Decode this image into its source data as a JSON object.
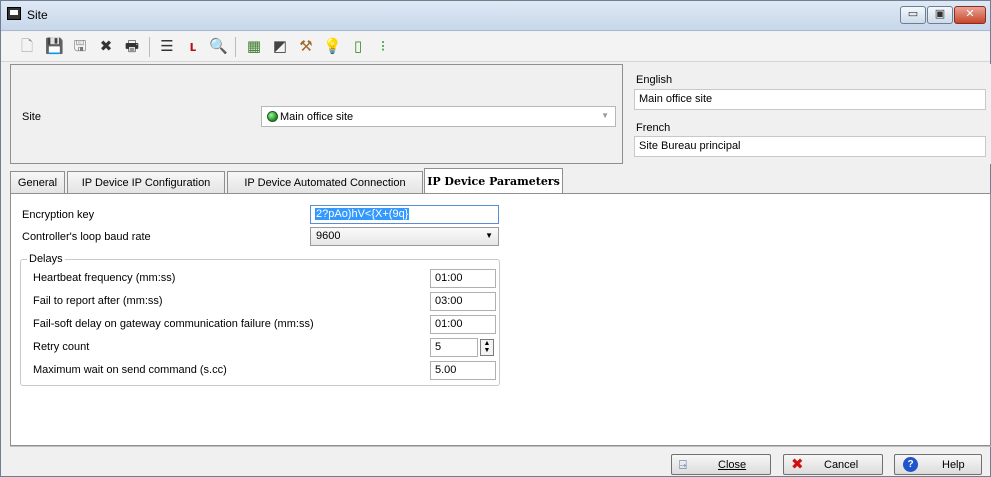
{
  "window": {
    "title": "Site",
    "min_glyph": "▭",
    "max_glyph": "▣",
    "close_glyph": "✕"
  },
  "toolbar": {
    "icons": [
      "new-icon",
      "save-icon",
      "save-copy-icon",
      "delete-icon",
      "print-icon",
      "list-icon",
      "filter-icon",
      "search-icon",
      "map-icon",
      "report-icon",
      "tools-icon",
      "tip-icon",
      "door-icon",
      "traffic-light-icon"
    ]
  },
  "header": {
    "site_label": "Site",
    "site_value": "Main office site",
    "english_label": "English",
    "english_value": "Main office site",
    "french_label": "French",
    "french_value": "Site Bureau principal"
  },
  "tabs": [
    {
      "label": "General"
    },
    {
      "label": "IP Device IP Configuration"
    },
    {
      "label": "IP Device Automated Connection"
    },
    {
      "label": "IP Device Parameters"
    }
  ],
  "params": {
    "encryption_key_label": "Encryption key",
    "encryption_key_value": "2?pAo)hV<{X+(9q}",
    "baud_rate_label": "Controller's loop baud rate",
    "baud_rate_value": "9600",
    "delays_title": "Delays",
    "heartbeat_label": "Heartbeat frequency (mm:ss)",
    "heartbeat_value": "01:00",
    "fail_report_label": "Fail to report after (mm:ss)",
    "fail_report_value": "03:00",
    "failsoft_label": "Fail-soft delay on gateway communication failure (mm:ss)",
    "failsoft_value": "01:00",
    "retry_label": "Retry count",
    "retry_value": "5",
    "max_wait_label": "Maximum wait on send command (s.cc)",
    "max_wait_value": "5.00"
  },
  "footer": {
    "close_label": "Close",
    "cancel_label": "Cancel",
    "help_label": "Help"
  },
  "colors": {
    "title_bar": "#c7d6ea",
    "selection": "#3399ff",
    "cancel_x": "#d01010",
    "help_icon": "#1f56c9"
  }
}
